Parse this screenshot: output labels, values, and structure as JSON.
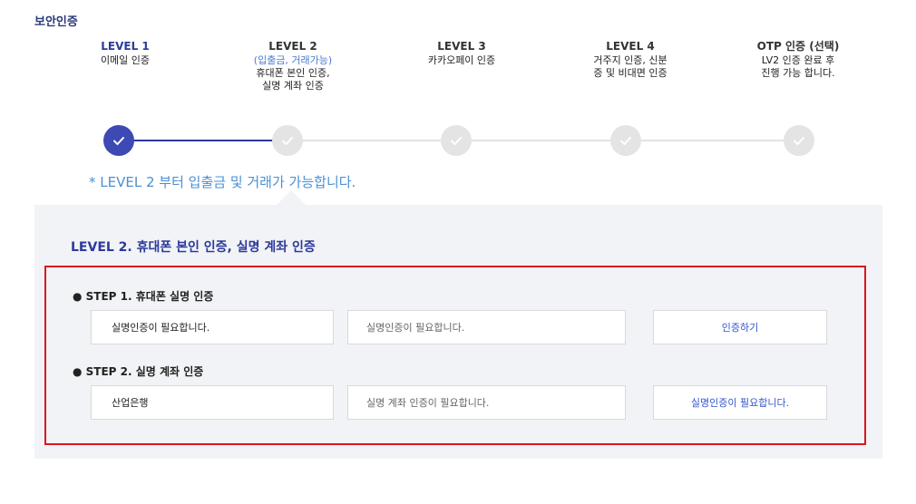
{
  "page_title": "보안인증",
  "levels": [
    {
      "title": "LEVEL 1",
      "sub": "",
      "desc": "이메일 인증"
    },
    {
      "title": "LEVEL 2",
      "sub": "(입출금, 거래가능)",
      "desc": "휴대폰 본인 인증,\n실명 계좌 인증"
    },
    {
      "title": "LEVEL 3",
      "sub": "",
      "desc": "카카오페이 인증"
    },
    {
      "title": "LEVEL 4",
      "sub": "",
      "desc": "거주지 인증, 신분\n증 및 비대면 인증"
    },
    {
      "title": "OTP 인증 (선택)",
      "sub": "",
      "desc": "LV2 인증 완료 후\n진행 가능 합니다."
    }
  ],
  "progress": {
    "completed_steps": 1,
    "total_steps": 5
  },
  "notice": "* LEVEL 2 부터 입출금 및 거래가 가능합니다.",
  "panel_title": "LEVEL 2. 휴대폰 본인 인증, 실명 계좌 인증",
  "steps": [
    {
      "label": "● STEP 1. 휴대폰 실명 인증",
      "field1": "실명인증이 필요합니다.",
      "field2": "실명인증이 필요합니다.",
      "button": "인증하기"
    },
    {
      "label": "● STEP 2. 실명 계좌 인증",
      "field1": "산업은행",
      "field2": "실명 계좌 인증이 필요합니다.",
      "button": "실명인증이 필요합니다."
    }
  ],
  "colors": {
    "accent": "#2b3a9a",
    "active_circle": "#3d4ab4",
    "inactive_circle": "#e4e4e4",
    "highlight_border": "#d9161c",
    "link_blue": "#3355cc"
  },
  "icons": {
    "check": "checkmark-icon"
  }
}
